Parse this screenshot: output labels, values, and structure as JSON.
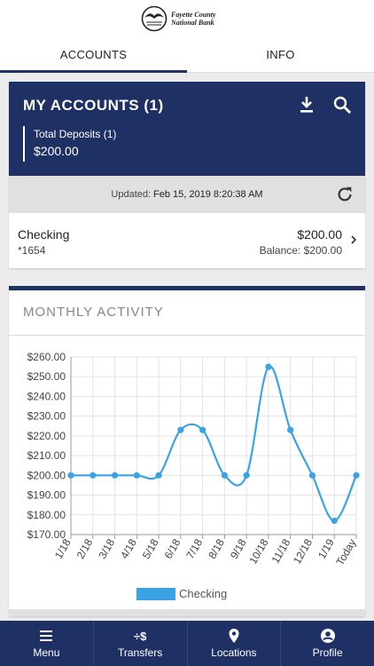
{
  "header": {
    "bank_name_line1": "Fayette County",
    "bank_name_line2": "National Bank"
  },
  "tabs": [
    {
      "label": "ACCOUNTS",
      "active": true
    },
    {
      "label": "INFO",
      "active": false
    }
  ],
  "accounts_card": {
    "title": "MY ACCOUNTS (1)",
    "deposits_label": "Total Deposits (1)",
    "deposits_amount": "$200.00",
    "updated_label": "Updated:",
    "updated_value": "Feb 15, 2019 8:20:38 AM",
    "account": {
      "name": "Checking",
      "number": "*1654",
      "amount": "$200.00",
      "balance": "Balance: $200.00"
    },
    "icons": {
      "download": "download-icon",
      "search": "search-icon",
      "refresh": "refresh-icon",
      "chevron": "chevron-right-icon"
    }
  },
  "activity": {
    "title": "MONTHLY ACTIVITY"
  },
  "chart_data": {
    "type": "line",
    "title": "MONTHLY ACTIVITY",
    "categories": [
      "1/18",
      "2/18",
      "3/18",
      "4/18",
      "5/18",
      "6/18",
      "7/18",
      "8/18",
      "9/18",
      "10/18",
      "11/18",
      "12/18",
      "1/19",
      "Today"
    ],
    "series": [
      {
        "name": "Checking",
        "values": [
          200,
          200,
          200,
          200,
          200,
          223,
          223,
          200,
          200,
          255,
          223,
          200,
          177,
          200
        ]
      }
    ],
    "ylim": [
      170,
      260
    ],
    "yticks": [
      "$170.00",
      "$180.00",
      "$190.00",
      "$200.00",
      "$210.00",
      "$220.00",
      "$230.00",
      "$240.00",
      "$250.00",
      "$260.00"
    ],
    "grid": true,
    "legend_position": "bottom",
    "color": "#3ba3e4"
  },
  "bottom_nav": [
    {
      "label": "Menu",
      "icon": "menu-icon"
    },
    {
      "label": "Transfers",
      "icon": "transfers-icon",
      "glyph": "÷$"
    },
    {
      "label": "Locations",
      "icon": "location-pin-icon"
    },
    {
      "label": "Profile",
      "icon": "profile-icon"
    }
  ],
  "colors": {
    "primary": "#1f3164",
    "accent": "#3ba3e4"
  }
}
